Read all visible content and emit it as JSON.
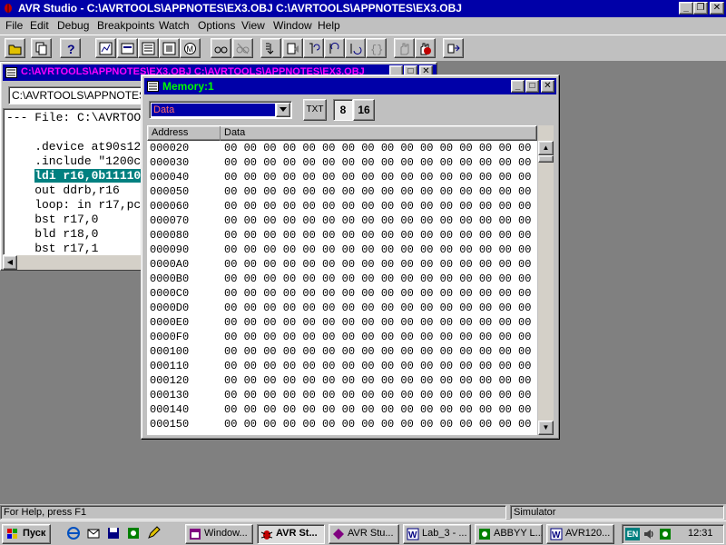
{
  "window": {
    "title": "AVR Studio - C:\\AVRTOOLS\\APPNOTES\\EX3.OBJ C:\\AVRTOOLS\\APPNOTES\\EX3.OBJ",
    "minimize": "_",
    "restore": "❐",
    "close": "✕"
  },
  "menu": [
    "File",
    "Edit",
    "Debug",
    "Breakpoints",
    "Watch",
    "Options",
    "View",
    "Window",
    "Help"
  ],
  "source_window": {
    "title": "C:\\AVRTOOLS\\APPNOTES\\EX3.OBJ C:\\AVRTOOLS\\APPNOTES\\EX3.OBJ",
    "combo": "C:\\AVRTOOLS\\APPNOTES",
    "lines": [
      "--- File: C:\\AVRTOO",
      "",
      "    .device at90s12",
      "    .include \"1200c",
      "    ldi r16,0b11110",
      "    out ddrb,r16",
      "    loop: in r17,pc",
      "    bst r17,0",
      "    bld r18,0",
      "    bst r17,1"
    ],
    "highlight_line": 4
  },
  "memory_window": {
    "title": "Memory:1",
    "type_value": "Data",
    "txt_label": "TXT",
    "btn8": "8",
    "btn16": "16",
    "col_address": "Address",
    "col_data": "Data",
    "data_line": "00 00 00 00 00 00 00 00 00 00 00 00 00 00 00 00",
    "addresses": [
      "000020",
      "000030",
      "000040",
      "000050",
      "000060",
      "000070",
      "000080",
      "000090",
      "0000A0",
      "0000B0",
      "0000C0",
      "0000D0",
      "0000E0",
      "0000F0",
      "000100",
      "000110",
      "000120",
      "000130",
      "000140",
      "000150"
    ]
  },
  "status": {
    "help": "For Help, press F1",
    "mode": "Simulator"
  },
  "taskbar": {
    "start": "Пуск",
    "tasks": [
      "Window...",
      "AVR St...",
      "AVR Stu...",
      "Lab_3 - ...",
      "ABBYY L...",
      "AVR120..."
    ],
    "lang": "EN",
    "clock": "12:31"
  }
}
